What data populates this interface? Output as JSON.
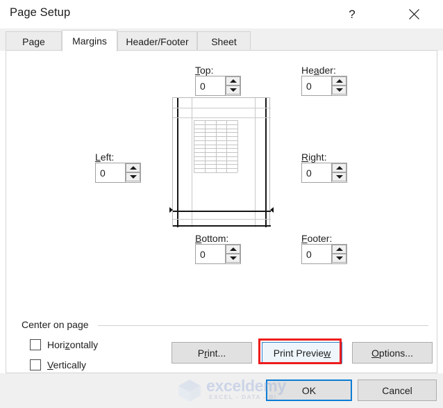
{
  "window": {
    "title": "Page Setup",
    "help_icon": "help-question-icon",
    "help_glyph": "?",
    "close_icon": "close-x-icon"
  },
  "tabs": [
    {
      "label": "Page",
      "selected": false
    },
    {
      "label": "Margins",
      "selected": true
    },
    {
      "label": "Header/Footer",
      "selected": false
    },
    {
      "label": "Sheet",
      "selected": false
    }
  ],
  "margins": {
    "top": {
      "label_pre": "",
      "label_key": "T",
      "label_post": "op:",
      "value": "0"
    },
    "header": {
      "label_pre": "He",
      "label_key": "a",
      "label_post": "der:",
      "value": "0"
    },
    "left": {
      "label_pre": "",
      "label_key": "L",
      "label_post": "eft:",
      "value": "0"
    },
    "right": {
      "label_pre": "",
      "label_key": "R",
      "label_post": "ight:",
      "value": "0"
    },
    "bottom": {
      "label_pre": "",
      "label_key": "B",
      "label_post": "ottom:",
      "value": "0"
    },
    "footer": {
      "label_pre": "",
      "label_key": "F",
      "label_post": "ooter:",
      "value": "0"
    }
  },
  "center_on_page": {
    "group_label": "Center on page",
    "horizontally": {
      "label_pre": "Hori",
      "label_key": "z",
      "label_post": "ontally",
      "checked": false
    },
    "vertically": {
      "label_pre": "",
      "label_key": "V",
      "label_post": "ertically",
      "checked": false
    }
  },
  "buttons": {
    "print": {
      "label_pre": "P",
      "label_key": "r",
      "label_post": "int..."
    },
    "print_preview": {
      "label_pre": "Print Previe",
      "label_key": "w",
      "label_post": "",
      "highlighted": true,
      "focused": true
    },
    "options": {
      "label_pre": "",
      "label_key": "O",
      "label_post": "ptions..."
    },
    "ok": {
      "label": "OK",
      "is_default": true
    },
    "cancel": {
      "label": "Cancel"
    }
  },
  "watermark": {
    "brand": "exceldemy",
    "tagline": "EXCEL - DATA - BI",
    "logo_icon": "exceldemy-cube-logo-icon"
  },
  "colors": {
    "accent_blue": "#0a7cd4",
    "highlight_red": "#ee1c1c",
    "dialog_bg": "#ffffff",
    "chrome_bg": "#f0f0f0",
    "button_face": "#e1e1e1"
  }
}
